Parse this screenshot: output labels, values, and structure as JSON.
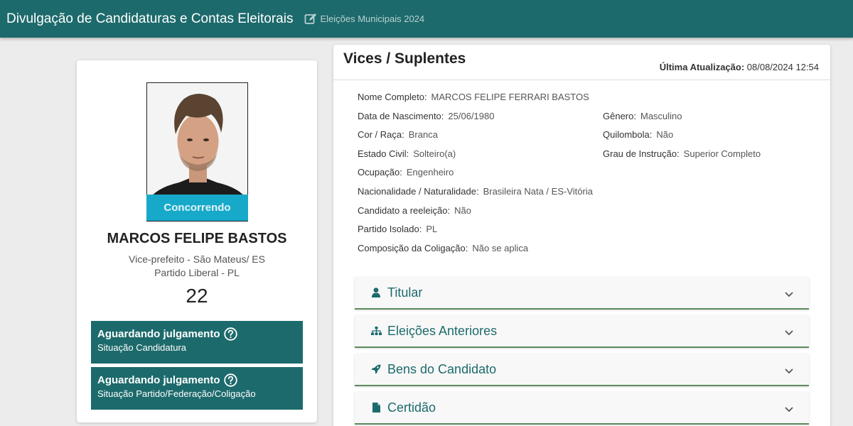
{
  "header": {
    "title": "Divulgação de Candidaturas e Contas Eleitorais",
    "election": "Eleições Municipais 2024",
    "election_icon": "edit-icon"
  },
  "candidate": {
    "status": "Concorrendo",
    "name": "MARCOS FELIPE BASTOS",
    "role": "Vice-prefeito - São Mateus/ ES",
    "party": "Partido Liberal - PL",
    "number": "22",
    "situations": [
      {
        "title": "Aguardando julgamento",
        "label": "Situação Candidatura"
      },
      {
        "title": "Aguardando julgamento",
        "label": "Situação Partido/Federação/Coligação"
      }
    ]
  },
  "details": {
    "title": "Vices / Suplentes",
    "updated_label": "Última Atualização:",
    "updated_value": "08/08/2024 12:54",
    "fields": {
      "nome_completo": {
        "label": "Nome Completo:",
        "value": "MARCOS FELIPE FERRARI BASTOS"
      },
      "data_nascimento": {
        "label": "Data de Nascimento:",
        "value": "25/06/1980"
      },
      "genero": {
        "label": "Gênero:",
        "value": "Masculino"
      },
      "cor_raca": {
        "label": "Cor / Raça:",
        "value": "Branca"
      },
      "quilombola": {
        "label": "Quilombola:",
        "value": "Não"
      },
      "estado_civil": {
        "label": "Estado Civil:",
        "value": "Solteiro(a)"
      },
      "grau_instrucao": {
        "label": "Grau de Instrução:",
        "value": "Superior Completo"
      },
      "ocupacao": {
        "label": "Ocupação:",
        "value": "Engenheiro"
      },
      "nacionalidade": {
        "label": "Nacionalidade / Naturalidade:",
        "value": "Brasileira Nata / ES-Vitória"
      },
      "reeleicao": {
        "label": "Candidato a reeleição:",
        "value": "Não"
      },
      "partido_isolado": {
        "label": "Partido Isolado:",
        "value": "PL"
      },
      "coligacao": {
        "label": "Composição da Coligação:",
        "value": "Não se aplica"
      }
    },
    "accordions": [
      {
        "label": "Titular",
        "icon": "user-icon"
      },
      {
        "label": "Eleições Anteriores",
        "icon": "sitemap-icon"
      },
      {
        "label": "Bens do Candidato",
        "icon": "rocket-icon"
      },
      {
        "label": "Certidão",
        "icon": "file-icon"
      }
    ]
  },
  "colors": {
    "primary": "#1d6a6c",
    "status": "#17a9c9",
    "accordion_border": "#5b8a5d"
  }
}
